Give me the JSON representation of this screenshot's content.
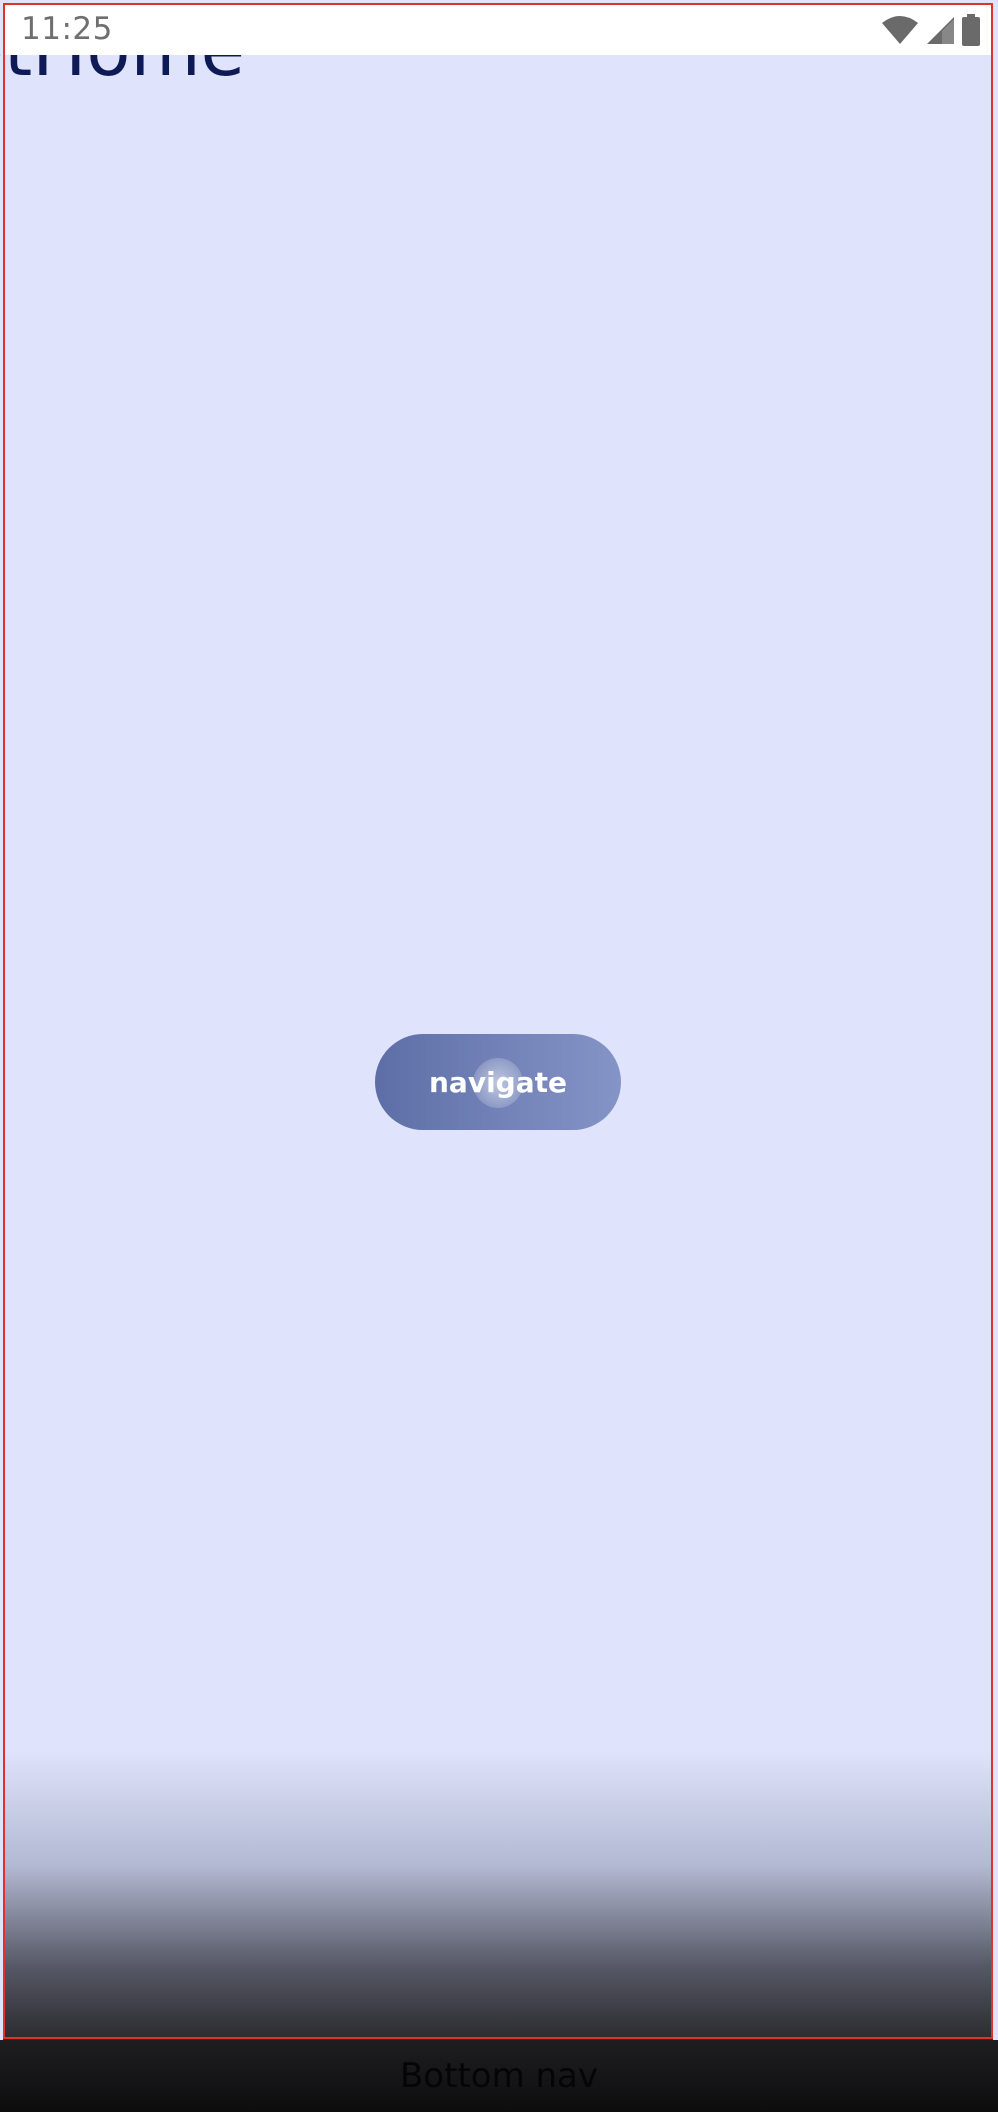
{
  "status_bar": {
    "time": "11:25",
    "icons": [
      "wifi-icon",
      "cellular-signal-icon",
      "battery-icon"
    ]
  },
  "page": {
    "title": "otHome"
  },
  "main": {
    "button_label": "navigate"
  },
  "bottom_nav": {
    "label": "Bottom nav"
  },
  "colors": {
    "background": "#dfe4fc",
    "button": "#6f7fb5",
    "title": "#0e1a55",
    "outline": "#e0312a"
  }
}
